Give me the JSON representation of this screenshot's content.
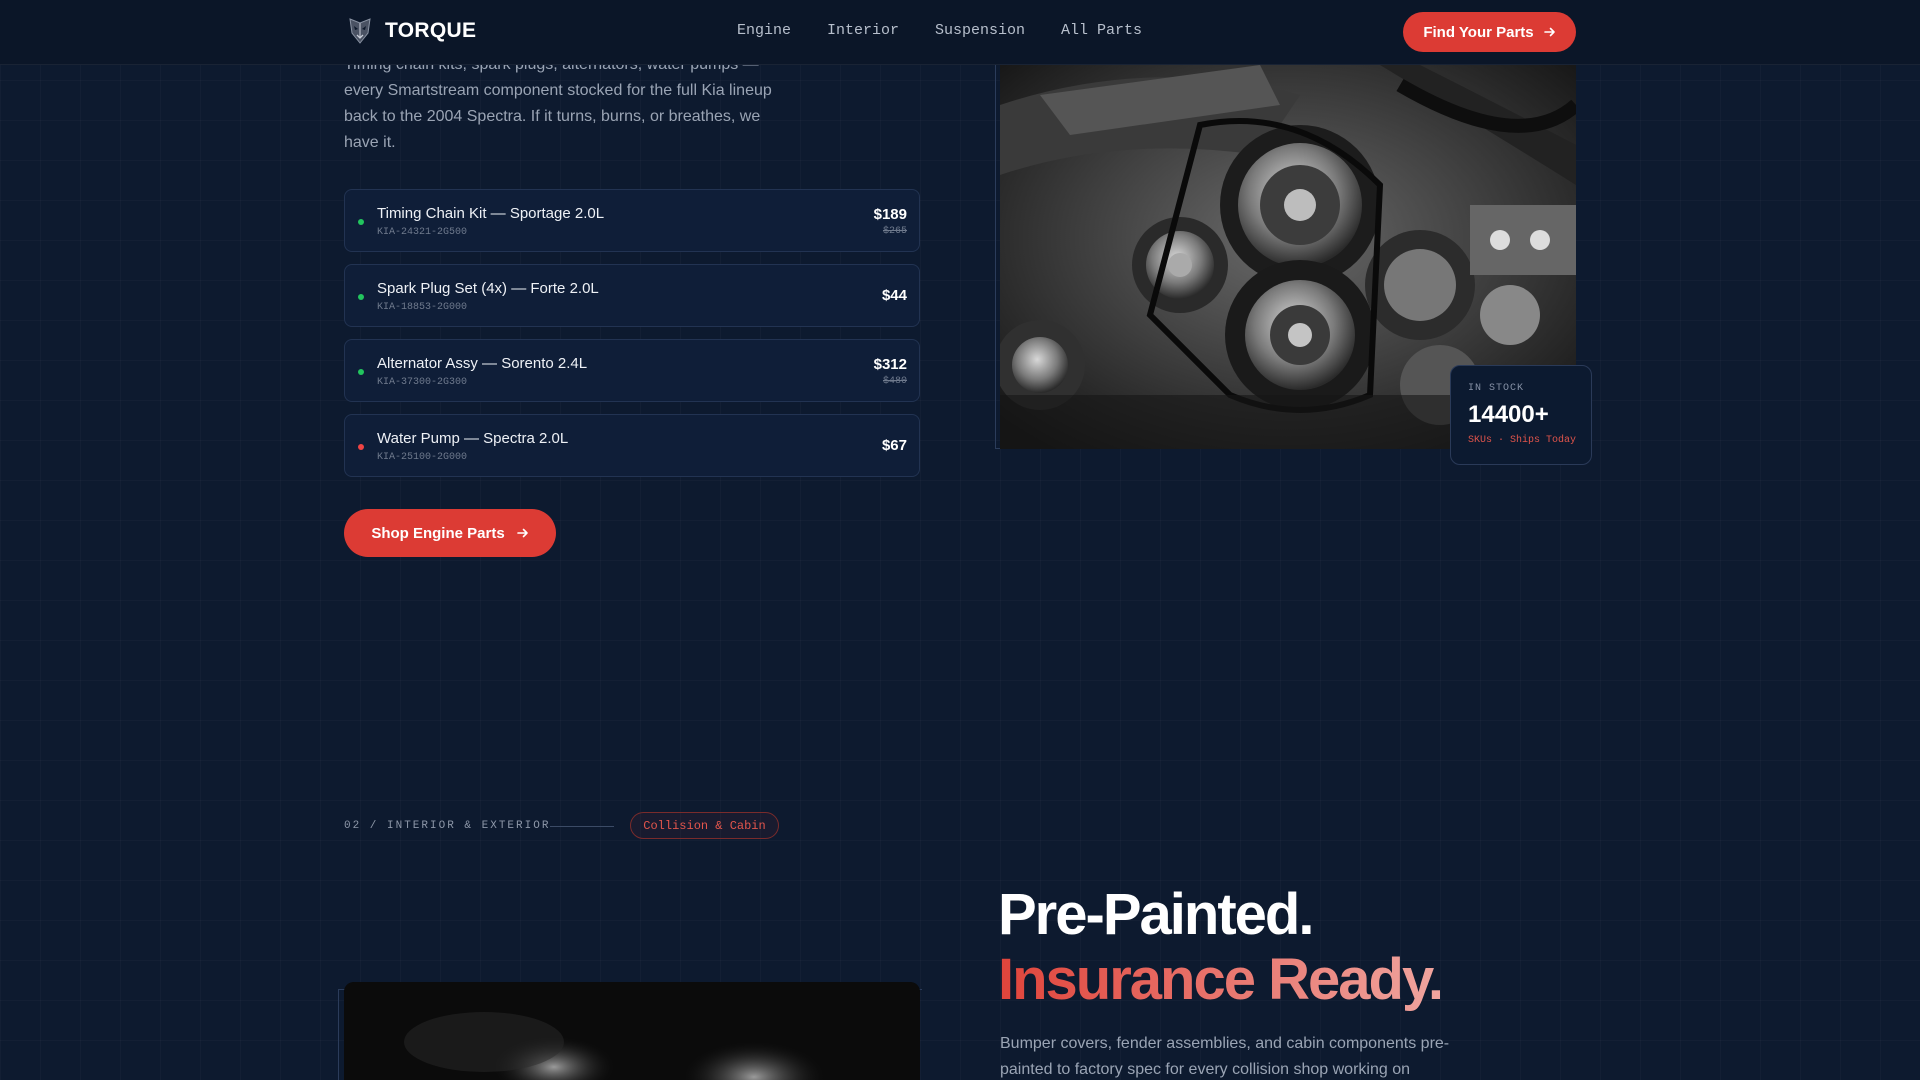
{
  "nav": {
    "brand": "TORQUE",
    "links": [
      "Engine",
      "Interior",
      "Suspension",
      "All Parts"
    ],
    "cta": "Find Your Parts"
  },
  "hero": {
    "intro": "Timing chain kits, spark plugs, alternators, water pumps — every Smartstream component stocked for the full Kia lineup back to the 2004 Spectra. If it turns, burns, or breathes, we have it.",
    "parts": [
      {
        "name": "Timing Chain Kit — Sportage 2.0L",
        "sku": "KIA-24321-2G500",
        "price": "$189",
        "old_price": "$265",
        "status": "in-stock"
      },
      {
        "name": "Spark Plug Set (4x) — Forte 2.0L",
        "sku": "KIA-18853-2G000",
        "price": "$44",
        "old_price": "",
        "status": "in-stock"
      },
      {
        "name": "Alternator Assy — Sorento 2.4L",
        "sku": "KIA-37300-2G300",
        "price": "$312",
        "old_price": "$480",
        "status": "in-stock"
      },
      {
        "name": "Water Pump — Spectra 2.0L",
        "sku": "KIA-25100-2G000",
        "price": "$67",
        "old_price": "",
        "status": "low-stock"
      }
    ],
    "shop_button": "Shop Engine Parts",
    "stock": {
      "label": "IN STOCK",
      "count": "14400+",
      "sub": "SKUs · Ships Today"
    }
  },
  "section2": {
    "label": "02 / INTERIOR & EXTERIOR",
    "badge": "Collision & Cabin",
    "headline_line1": "Pre-Painted.",
    "headline_line2": "Insurance Ready.",
    "description": "Bumper covers, fender assemblies, and cabin components pre-painted to factory spec for every collision shop working on"
  },
  "colors": {
    "accent": "#dc3b34",
    "background": "#0d1a2f",
    "in_stock": "#22c55e",
    "low_stock": "#ef4444"
  },
  "icons": {
    "logo": "mask-logo-icon",
    "arrow": "arrow-right-icon"
  }
}
